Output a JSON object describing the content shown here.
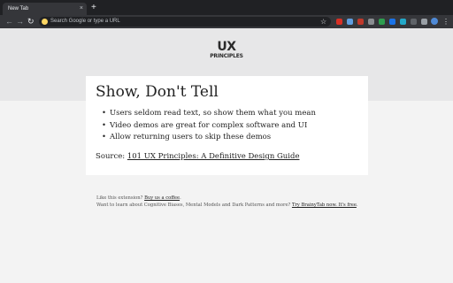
{
  "browser": {
    "tab": {
      "title": "New Tab",
      "close": "×"
    },
    "new_tab": "+",
    "nav": {
      "back": "←",
      "forward": "→",
      "reload": "↻"
    },
    "omnibox": {
      "placeholder": "Search Google or type a URL"
    },
    "bookmark": "☆",
    "menu": "⋮",
    "extensions": [
      {
        "name": "ext-red-badge-icon",
        "color": "#d93025"
      },
      {
        "name": "ext-shield-icon",
        "color": "#5f9ee0"
      },
      {
        "name": "ext-block-icon",
        "color": "#c0392b"
      },
      {
        "name": "ext-gray-icon",
        "color": "#8a8d91"
      },
      {
        "name": "ext-green-icon",
        "color": "#2e9e4f"
      },
      {
        "name": "ext-blue-icon",
        "color": "#1a73e8"
      },
      {
        "name": "ext-teal-icon",
        "color": "#23a8c8"
      },
      {
        "name": "ext-dark-icon",
        "color": "#5f6368"
      },
      {
        "name": "ext-k-icon",
        "color": "#9aa0a6"
      }
    ]
  },
  "logo": {
    "line1": "UX",
    "line2": "PRINCIPLES"
  },
  "card": {
    "title": "Show, Don't Tell",
    "items": [
      "Users seldom read text, so show them what you mean",
      "Video demos are great for complex software and UI",
      "Allow returning users to skip these demos"
    ],
    "source_label": "Source:",
    "source_link": "101 UX Principles: A Definitive Design Guide"
  },
  "footer": {
    "line1_text": "Like this extension?",
    "line1_link": "Buy us a coffee",
    "line1_end": ".",
    "line2_text": "Want to learn about Cognitive Biases, Mental Models and Dark Patterns and more?",
    "line2_link": "Try BrainyTab now. It's free",
    "line2_end": "."
  }
}
